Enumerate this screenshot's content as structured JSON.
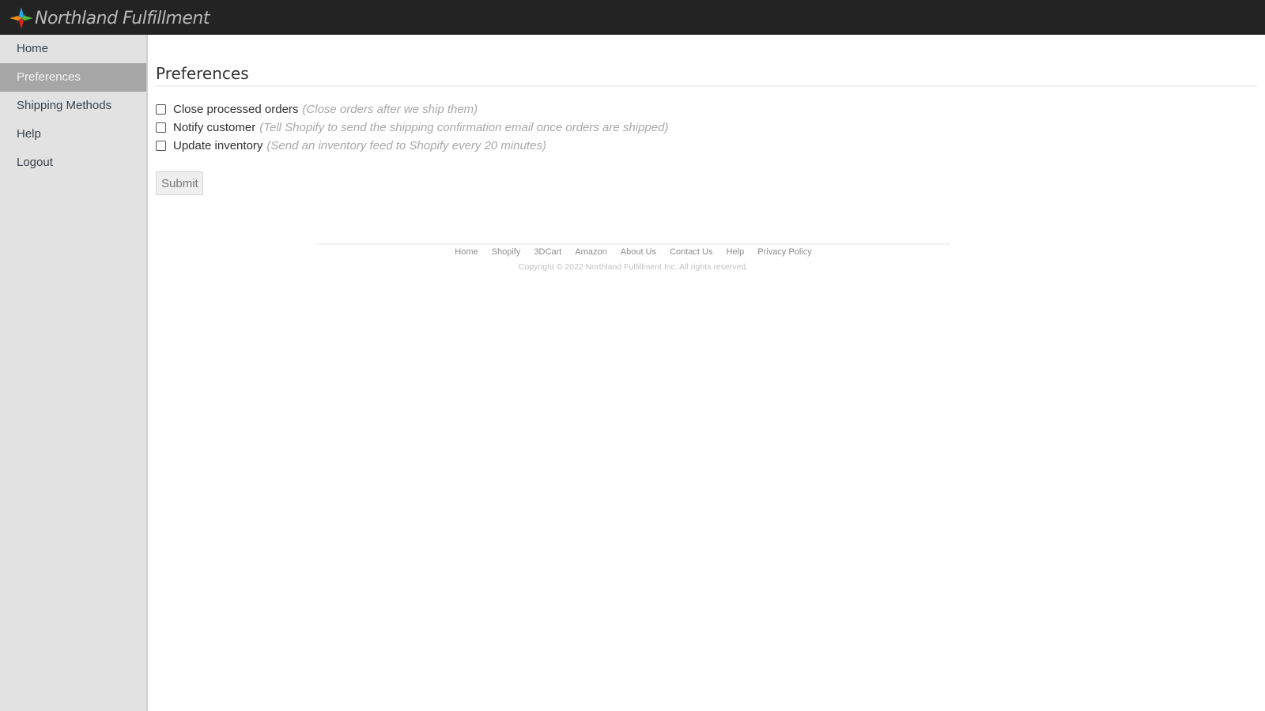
{
  "header": {
    "brand": "Northland Fulfillment",
    "logo_icon": "four-point-star-logo"
  },
  "sidebar": {
    "items": [
      {
        "label": "Home",
        "active": false
      },
      {
        "label": "Preferences",
        "active": true
      },
      {
        "label": "Shipping Methods",
        "active": false
      },
      {
        "label": "Help",
        "active": false
      },
      {
        "label": "Logout",
        "active": false
      }
    ]
  },
  "main": {
    "title": "Preferences",
    "options": [
      {
        "label": "Close processed orders",
        "hint": "(Close orders after we ship them)",
        "checked": false
      },
      {
        "label": "Notify customer",
        "hint": "(Tell Shopify to send the shipping confirmation email once orders are shipped)",
        "checked": false
      },
      {
        "label": "Update inventory",
        "hint": "(Send an inventory feed to Shopify every 20 minutes)",
        "checked": false
      }
    ],
    "submit_label": "Submit"
  },
  "footer": {
    "links": [
      "Home",
      "Shopify",
      "3DCart",
      "Amazon",
      "About Us",
      "Contact Us",
      "Help",
      "Privacy Policy"
    ],
    "copyright": "Copyright © 2022 Northland Fulfillment Inc. All rights reserved."
  }
}
